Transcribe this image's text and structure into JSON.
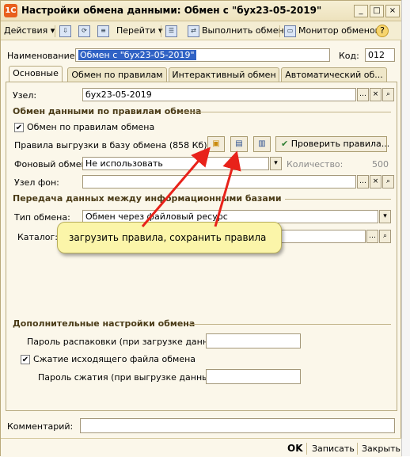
{
  "window": {
    "title": "Настройки обмена данными: Обмен с \"бух23-05-2019\"",
    "controls": [
      "_",
      "□",
      "×"
    ]
  },
  "toolbar": {
    "actions": "Действия",
    "goto": "Перейти",
    "run_exchange": "Выполнить обмен",
    "monitor": "Монитор обменов",
    "help": "?"
  },
  "header": {
    "name_label": "Наименование:",
    "name_value": "Обмен с \"бух23-05-2019\"",
    "code_label": "Код:",
    "code_value": "012"
  },
  "tabs": [
    "Основные",
    "Обмен по правилам",
    "Интерактивный обмен",
    "Автоматический об..."
  ],
  "main": {
    "node_label": "Узел:",
    "node_value": "бух23-05-2019",
    "section_rules": "Обмен данными по правилам обмена",
    "rules_checkbox": "Обмен по правилам обмена",
    "rules_label": "Правила выгрузки в базу обмена (858 Кб)",
    "check_rules_button": "Проверить правила...",
    "bg_exchange_label": "Фоновый обмен:",
    "bg_exchange_value": "Не использовать",
    "count_label": "Количество:",
    "count_value": "500",
    "bg_node_label": "Узел фон:",
    "section_transfer": "Передача данных между информационными базами",
    "type_label": "Тип обмена:",
    "type_value": "Обмен через файловый ресурс",
    "catalog_label": "Каталог:",
    "section_extra": "Дополнительные настройки обмена",
    "unpack_pass_label": "Пароль распаковки (при загрузке данных):",
    "compress_checkbox": "Сжатие исходящего файла обмена",
    "compress_pass_label": "Пароль сжатия (при выгрузке данных):"
  },
  "callout": "загрузить правила, сохранить правила",
  "comment_label": "Комментарий:",
  "footer": {
    "ok": "OK",
    "save": "Записать",
    "close": "Закрыть"
  },
  "colors": {
    "window_bg": "#fbf7ea",
    "callout_bg": "#fbf5a9",
    "arrow": "#e8221a",
    "selection": "#3163c5"
  }
}
